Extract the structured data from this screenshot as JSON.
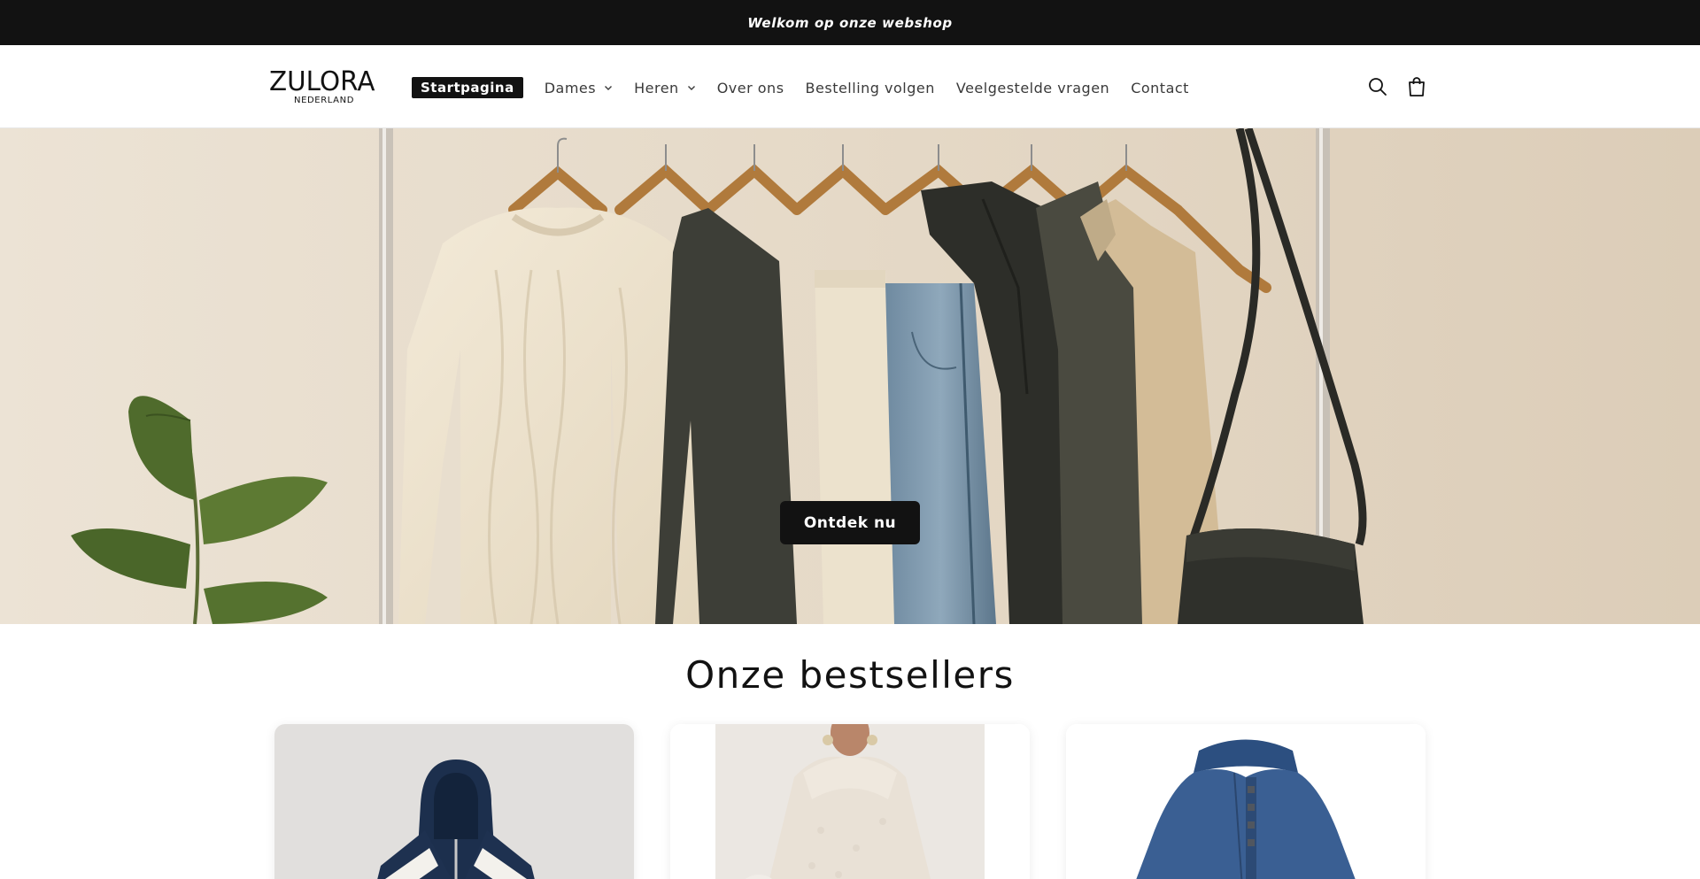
{
  "announcement": {
    "text": "Welkom op onze webshop"
  },
  "header": {
    "logo": {
      "name": "ZULORA",
      "sub": "NEDERLAND"
    },
    "nav": [
      {
        "label": "Startpagina",
        "active": true,
        "dropdown": false
      },
      {
        "label": "Dames",
        "active": false,
        "dropdown": true
      },
      {
        "label": "Heren",
        "active": false,
        "dropdown": true
      },
      {
        "label": "Over ons",
        "active": false,
        "dropdown": false
      },
      {
        "label": "Bestelling volgen",
        "active": false,
        "dropdown": false
      },
      {
        "label": "Veelgestelde vragen",
        "active": false,
        "dropdown": false
      },
      {
        "label": "Contact",
        "active": false,
        "dropdown": false
      }
    ],
    "icons": [
      "search-icon",
      "cart-icon"
    ]
  },
  "hero": {
    "cta_label": "Ontdek nu"
  },
  "bestsellers": {
    "title": "Onze bestsellers",
    "products": [
      {
        "image": "navy-white-zip-hoodie"
      },
      {
        "image": "cream-fleece-hoodie-model"
      },
      {
        "image": "blue-zip-jacket"
      }
    ]
  },
  "colors": {
    "bar": "#121212",
    "accent": "#121212",
    "background": "#ffffff"
  }
}
